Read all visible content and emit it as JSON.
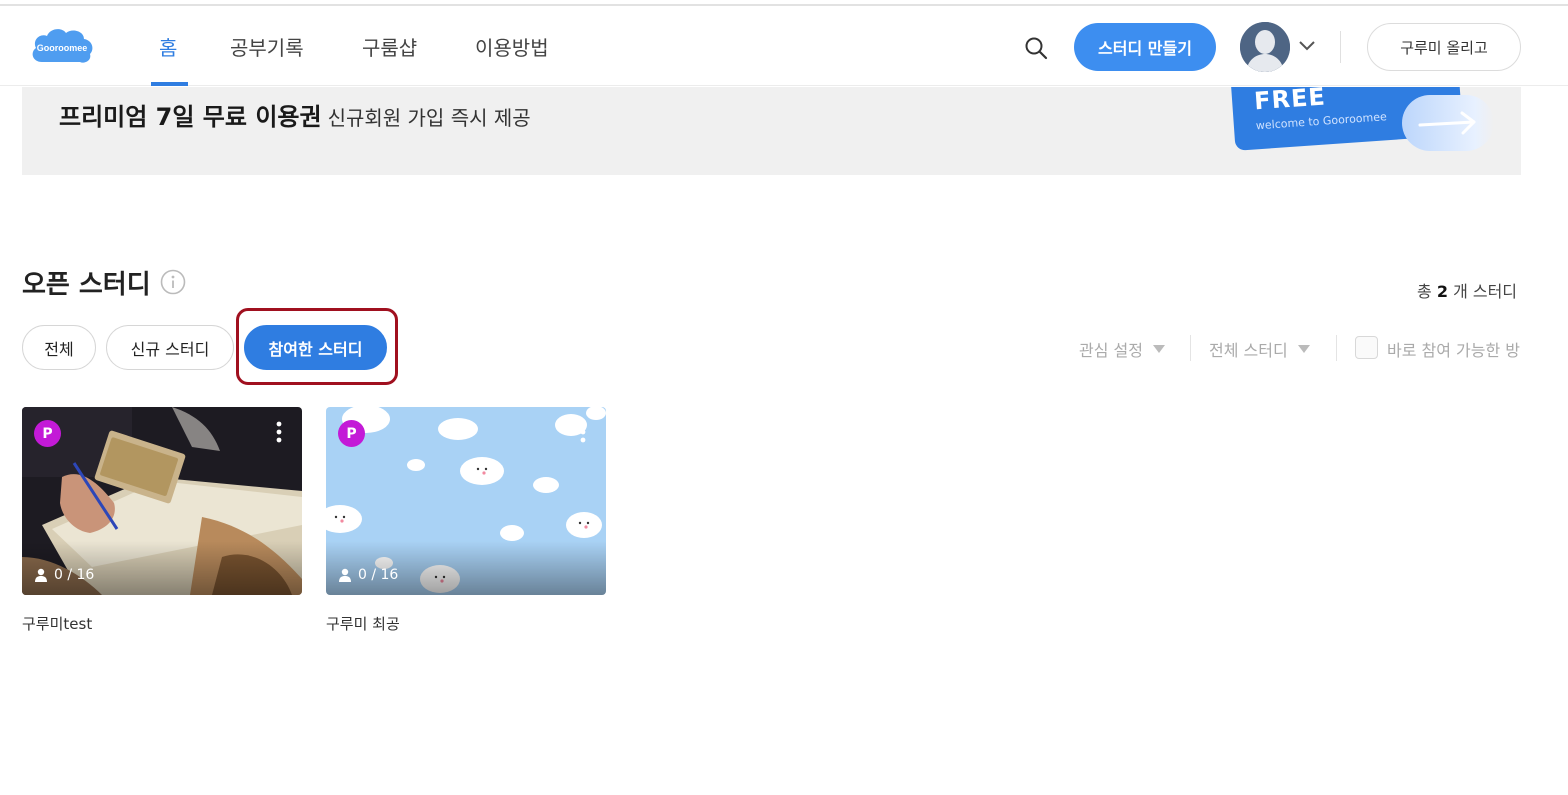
{
  "header": {
    "logo_text": "Gooroomee",
    "nav": [
      {
        "label": "홈",
        "active": true
      },
      {
        "label": "공부기록",
        "active": false
      },
      {
        "label": "구룸샵",
        "active": false
      },
      {
        "label": "이용방법",
        "active": false
      }
    ],
    "create_study_label": "스터디 만들기",
    "upload_label": "구루미 올리고",
    "icons": [
      "search-icon",
      "avatar",
      "chevron-down-icon"
    ]
  },
  "banner": {
    "headline": "프리미엄 7일 무료 이용권",
    "subtext": "신규회원 가입 즉시 제공",
    "card_free": "FREE",
    "card_text": "welcome to Gooroomee"
  },
  "section": {
    "title": "오픈 스터디",
    "total_prefix": "총",
    "total_count": "2",
    "total_suffix": "개 스터디",
    "chips": [
      {
        "label": "전체",
        "active": false
      },
      {
        "label": "신규 스터디",
        "active": false
      },
      {
        "label": "참여한 스터디",
        "active": true
      }
    ],
    "filters": {
      "interest": "관심 설정",
      "all_studies": "전체 스터디",
      "join_now": "바로 참여 가능한 방"
    }
  },
  "studies": [
    {
      "title": "구루미test",
      "badge": "P",
      "members": "0 / 16"
    },
    {
      "title": "구루미 최공",
      "badge": "P",
      "members": "0 / 16"
    }
  ],
  "colors": {
    "accent": "#2f7de1",
    "badge": "#c31ad7",
    "highlight": "#a0101f"
  }
}
